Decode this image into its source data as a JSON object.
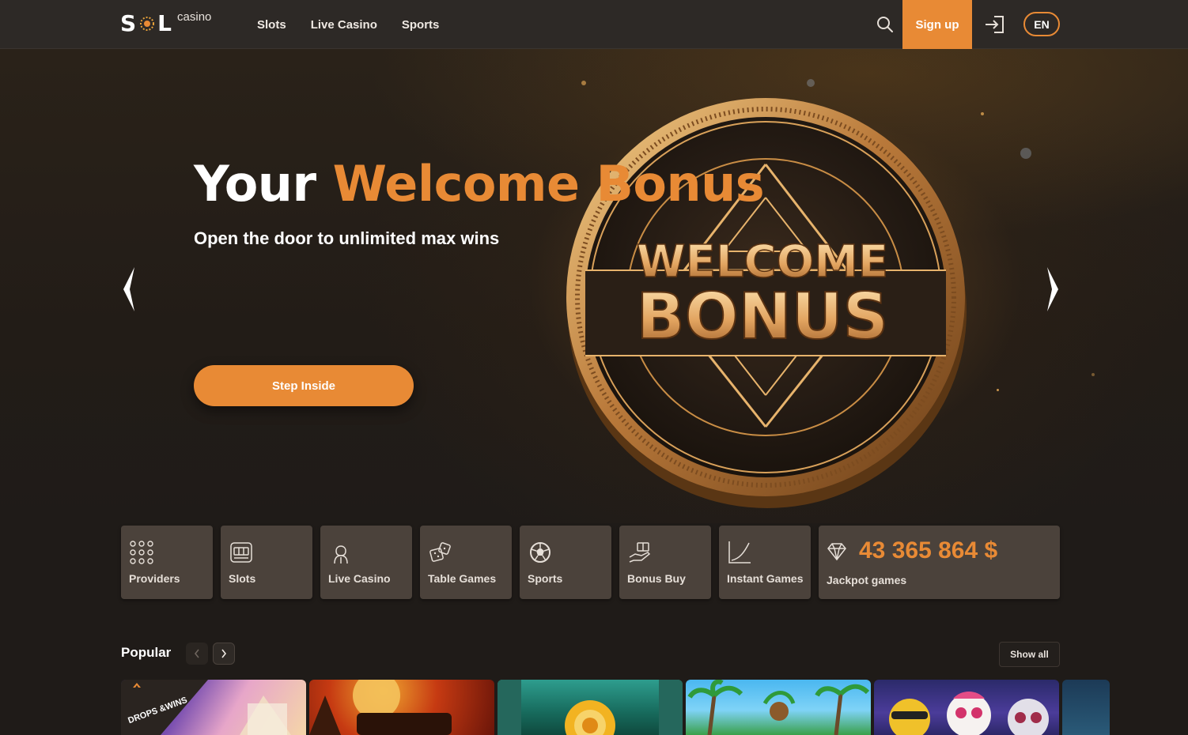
{
  "header": {
    "brand": "SOL",
    "brand_suffix": "casino",
    "nav": [
      "Slots",
      "Live Casino",
      "Sports"
    ],
    "signup_label": "Sign up",
    "lang": "EN"
  },
  "hero": {
    "title_part1": "Your",
    "title_accent": "Welcome Bonus",
    "subtitle": "Open the door to unlimited max wins",
    "cta": "Step Inside",
    "coin_line1": "WELCOME",
    "coin_line2": "BONUS"
  },
  "categories": [
    {
      "label": "Providers",
      "icon": "grid-dots-icon"
    },
    {
      "label": "Slots",
      "icon": "slot-machine-icon"
    },
    {
      "label": "Live Casino",
      "icon": "dealer-icon"
    },
    {
      "label": "Table Games",
      "icon": "dice-icon"
    },
    {
      "label": "Sports",
      "icon": "soccer-ball-icon"
    },
    {
      "label": "Bonus Buy",
      "icon": "hand-gift-icon"
    },
    {
      "label": "Instant Games",
      "icon": "rising-curve-icon"
    }
  ],
  "jackpot": {
    "amount": "43 365 864 $",
    "label": "Jackpot games",
    "icon": "diamond-icon"
  },
  "popular": {
    "title": "Popular",
    "show_all": "Show all",
    "first_game_badge": "DROPS &WINS"
  },
  "colors": {
    "accent": "#e88a35",
    "header_bg": "#2d2926",
    "page_bg": "#1f1b18",
    "tile_bg": "#4b423b"
  }
}
